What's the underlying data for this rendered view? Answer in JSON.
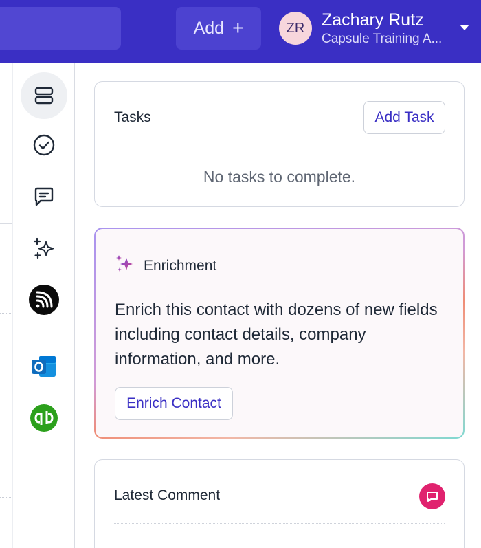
{
  "header": {
    "add_label": "Add",
    "add_icon": "+",
    "user": {
      "initials": "ZR",
      "name": "Zachary Rutz",
      "org": "Capsule Training A..."
    }
  },
  "rail": {
    "items": [
      {
        "name": "record-details-icon",
        "active": true
      },
      {
        "name": "tasks-check-icon",
        "active": false
      },
      {
        "name": "comments-icon",
        "active": false
      },
      {
        "name": "ai-sparkle-icon",
        "active": false
      },
      {
        "name": "integration-rss-icon",
        "active": false
      },
      {
        "name": "outlook-icon",
        "active": false
      },
      {
        "name": "quickbooks-icon",
        "active": false
      }
    ]
  },
  "tasks": {
    "title": "Tasks",
    "add_label": "Add Task",
    "empty_text": "No tasks to complete."
  },
  "enrichment": {
    "title": "Enrichment",
    "body": "Enrich this contact with dozens of new fields including contact details, company information, and more.",
    "button_label": "Enrich Contact"
  },
  "comment": {
    "title": "Latest Comment",
    "badge_color": "#e0226e"
  },
  "colors": {
    "brand": "#3a2fc4",
    "accent_pink": "#e0226e",
    "quickbooks_green": "#2ca01c",
    "outlook_blue": "#0f6cbd"
  }
}
